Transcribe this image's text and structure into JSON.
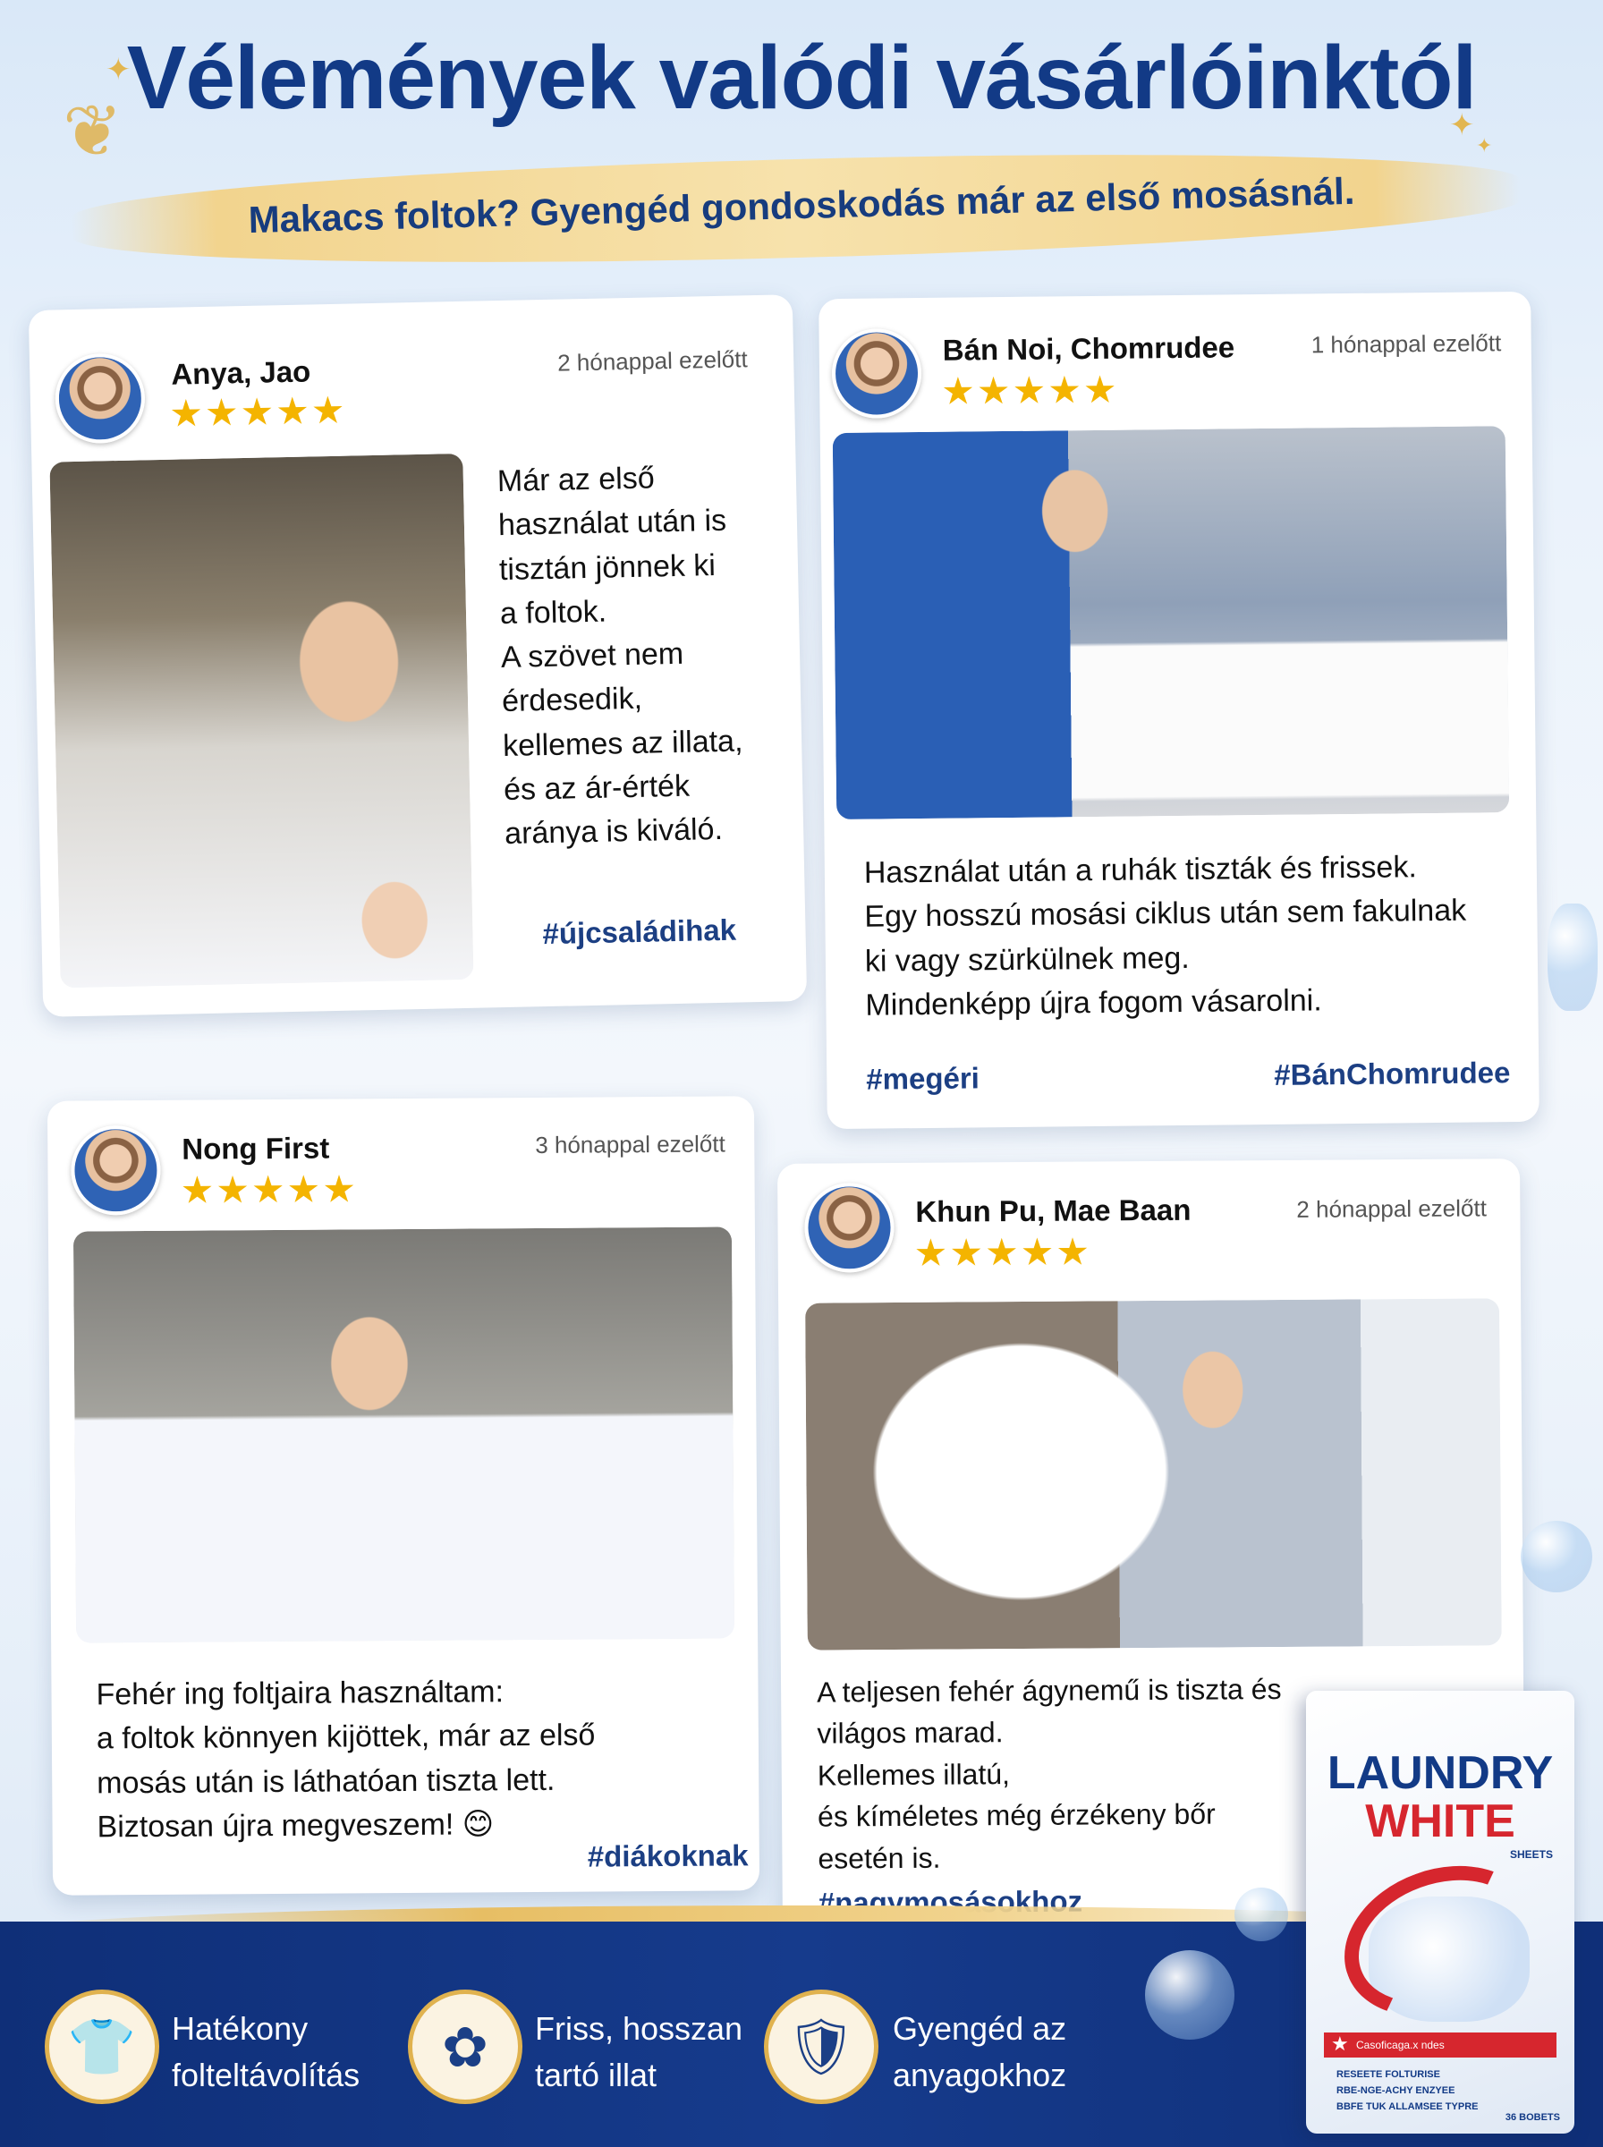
{
  "header": {
    "title": "Vélemények valódi vásárlóinktól",
    "subtitle": "Makacs foltok? Gyengéd gondoskodás már az első mosásnál."
  },
  "reviews": [
    {
      "name": "Anya, Jao",
      "time": "2 hónappal ezelőtt",
      "stars": "★★★★★",
      "rating": 5,
      "lines": [
        "Már az első",
        "használat után is",
        "tisztán jönnek ki",
        "a foltok.",
        "A szövet nem",
        "érdesedik,",
        "kellemes az illata,",
        "és az ár-érték",
        "aránya is kiváló."
      ],
      "tags": [
        "#újcsaládihak"
      ]
    },
    {
      "name": "Bán Noi, Chomrudee",
      "time": "1 hónappal ezelőtt",
      "stars": "★★★★★",
      "rating": 5,
      "lines": [
        "Használat után a ruhák tiszták és frissek.",
        "Egy hosszú mosási ciklus után sem fakulnak",
        "ki vagy szürkülnek meg.",
        "Mindenképp újra fogom vásarolni."
      ],
      "tags": [
        "#megéri",
        "#BánChomrudee"
      ]
    },
    {
      "name": "Nong First",
      "time": "3 hónappal ezelőtt",
      "stars": "★★★★★",
      "rating": 5,
      "lines": [
        "Fehér ing foltjaira használtam:",
        "a foltok könnyen kijöttek, már az első",
        "mosás után is láthatóan tiszta lett.",
        "Biztosan újra megveszem! 😊"
      ],
      "tags": [
        "#diákoknak"
      ]
    },
    {
      "name": "Khun Pu, Mae Baan",
      "time": "2 hónappal ezelőtt",
      "stars": "★★★★★",
      "rating": 5,
      "lines": [
        "A teljesen fehér ágynemű is tiszta és",
        "világos marad.",
        "Kellemes illatú,",
        "és kíméletes még érzékeny bőr",
        "esetén is."
      ],
      "tags": [
        "#nagymosásokhoz"
      ]
    }
  ],
  "features": [
    {
      "icon": "tshirt-icon",
      "glyph": "👕",
      "lines": [
        "Hatékony",
        "folteltávolítás"
      ]
    },
    {
      "icon": "flower-icon",
      "glyph": "✿",
      "lines": [
        "Friss, hosszan",
        "tartó illat"
      ]
    },
    {
      "icon": "shield-check-icon",
      "glyph": "🛡",
      "lines": [
        "Gyengéd az",
        "anyagokhoz"
      ]
    }
  ],
  "product": {
    "brand_line1": "LAUNDRY",
    "brand_line2": "WHITE",
    "sheets_label": "SHEETS",
    "badge": "Casoficaga.x ndes",
    "list": [
      "RESEETE FOLTURISE",
      "RBE-NGE-ACHY ENZYEE",
      "BBFE TUK ALLAMSEE TYPRE"
    ],
    "count": "36 BOBETS"
  },
  "colors": {
    "title_blue": "#123a86",
    "gold": "#e0b24f",
    "star": "#f4b400",
    "band_blue": "#163b8c",
    "brand_red": "#d6262e"
  }
}
